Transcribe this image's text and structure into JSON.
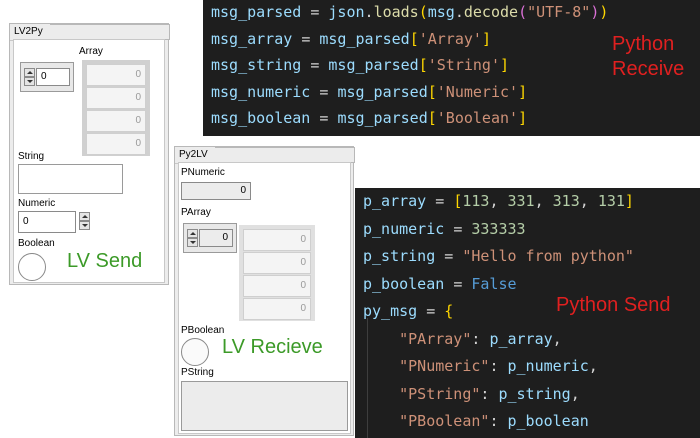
{
  "lv2py": {
    "title": "LV2Py",
    "array_label": "Array",
    "array_index": "0",
    "array_values": [
      "0",
      "0",
      "0",
      "0"
    ],
    "string_label": "String",
    "string_value": "",
    "numeric_label": "Numeric",
    "numeric_value": "0",
    "boolean_label": "Boolean",
    "caption": "LV Send"
  },
  "py2lv": {
    "title": "Py2LV",
    "pnumeric_label": "PNumeric",
    "pnumeric_value": "0",
    "parray_label": "PArray",
    "parray_index": "0",
    "parray_values": [
      "0",
      "0",
      "0",
      "0"
    ],
    "pboolean_label": "PBoolean",
    "pstring_label": "PString",
    "pstring_value": "",
    "caption": "LV Recieve"
  },
  "receive_code": {
    "caption_line1": "Python",
    "caption_line2": "Receive",
    "lines": [
      [
        {
          "t": "msg_parsed ",
          "c": "v"
        },
        {
          "t": "= ",
          "c": "pun"
        },
        {
          "t": "json",
          "c": "v"
        },
        {
          "t": ".",
          "c": "pun"
        },
        {
          "t": "loads",
          "c": "fn"
        },
        {
          "t": "(",
          "c": "b1"
        },
        {
          "t": "msg",
          "c": "v"
        },
        {
          "t": ".",
          "c": "pun"
        },
        {
          "t": "decode",
          "c": "fn"
        },
        {
          "t": "(",
          "c": "b2"
        },
        {
          "t": "\"UTF-8\"",
          "c": "str"
        },
        {
          "t": ")",
          "c": "b2"
        },
        {
          "t": ")",
          "c": "b1"
        }
      ],
      [
        {
          "t": "msg_array ",
          "c": "v"
        },
        {
          "t": "= ",
          "c": "pun"
        },
        {
          "t": "msg_parsed",
          "c": "v"
        },
        {
          "t": "[",
          "c": "b1"
        },
        {
          "t": "'Array'",
          "c": "str"
        },
        {
          "t": "]",
          "c": "b1"
        }
      ],
      [
        {
          "t": "msg_string ",
          "c": "v"
        },
        {
          "t": "= ",
          "c": "pun"
        },
        {
          "t": "msg_parsed",
          "c": "v"
        },
        {
          "t": "[",
          "c": "b1"
        },
        {
          "t": "'String'",
          "c": "str"
        },
        {
          "t": "]",
          "c": "b1"
        }
      ],
      [
        {
          "t": "msg_numeric ",
          "c": "v"
        },
        {
          "t": "= ",
          "c": "pun"
        },
        {
          "t": "msg_parsed",
          "c": "v"
        },
        {
          "t": "[",
          "c": "b1"
        },
        {
          "t": "'Numeric'",
          "c": "str"
        },
        {
          "t": "]",
          "c": "b1"
        }
      ],
      [
        {
          "t": "msg_boolean ",
          "c": "v"
        },
        {
          "t": "= ",
          "c": "pun"
        },
        {
          "t": "msg_parsed",
          "c": "v"
        },
        {
          "t": "[",
          "c": "b1"
        },
        {
          "t": "'Boolean'",
          "c": "str"
        },
        {
          "t": "]",
          "c": "b1"
        }
      ]
    ]
  },
  "send_code": {
    "caption": "Python Send",
    "lines": [
      [
        {
          "t": "p_array ",
          "c": "v"
        },
        {
          "t": "= ",
          "c": "pun"
        },
        {
          "t": "[",
          "c": "b1"
        },
        {
          "t": "113",
          "c": "num"
        },
        {
          "t": ", ",
          "c": "pun"
        },
        {
          "t": "331",
          "c": "num"
        },
        {
          "t": ", ",
          "c": "pun"
        },
        {
          "t": "313",
          "c": "num"
        },
        {
          "t": ", ",
          "c": "pun"
        },
        {
          "t": "131",
          "c": "num"
        },
        {
          "t": "]",
          "c": "b1"
        }
      ],
      [
        {
          "t": "p_numeric ",
          "c": "v"
        },
        {
          "t": "= ",
          "c": "pun"
        },
        {
          "t": "333333",
          "c": "num"
        }
      ],
      [
        {
          "t": "p_string ",
          "c": "v"
        },
        {
          "t": "= ",
          "c": "pun"
        },
        {
          "t": "\"Hello from python\"",
          "c": "str"
        }
      ],
      [
        {
          "t": "p_boolean ",
          "c": "v"
        },
        {
          "t": "= ",
          "c": "pun"
        },
        {
          "t": "False",
          "c": "kw"
        }
      ],
      [
        {
          "t": "py_msg ",
          "c": "v"
        },
        {
          "t": "= ",
          "c": "pun"
        },
        {
          "t": "{",
          "c": "b1"
        }
      ],
      [
        {
          "t": "    ",
          "c": "pun"
        },
        {
          "t": "\"PArray\"",
          "c": "str"
        },
        {
          "t": ": ",
          "c": "pun"
        },
        {
          "t": "p_array",
          "c": "v"
        },
        {
          "t": ",",
          "c": "pun"
        }
      ],
      [
        {
          "t": "    ",
          "c": "pun"
        },
        {
          "t": "\"PNumeric\"",
          "c": "str"
        },
        {
          "t": ": ",
          "c": "pun"
        },
        {
          "t": "p_numeric",
          "c": "v"
        },
        {
          "t": ",",
          "c": "pun"
        }
      ],
      [
        {
          "t": "    ",
          "c": "pun"
        },
        {
          "t": "\"PString\"",
          "c": "str"
        },
        {
          "t": ": ",
          "c": "pun"
        },
        {
          "t": "p_string",
          "c": "v"
        },
        {
          "t": ",",
          "c": "pun"
        }
      ],
      [
        {
          "t": "    ",
          "c": "pun"
        },
        {
          "t": "\"PBoolean\"",
          "c": "str"
        },
        {
          "t": ": ",
          "c": "pun"
        },
        {
          "t": "p_boolean",
          "c": "v"
        }
      ]
    ]
  }
}
